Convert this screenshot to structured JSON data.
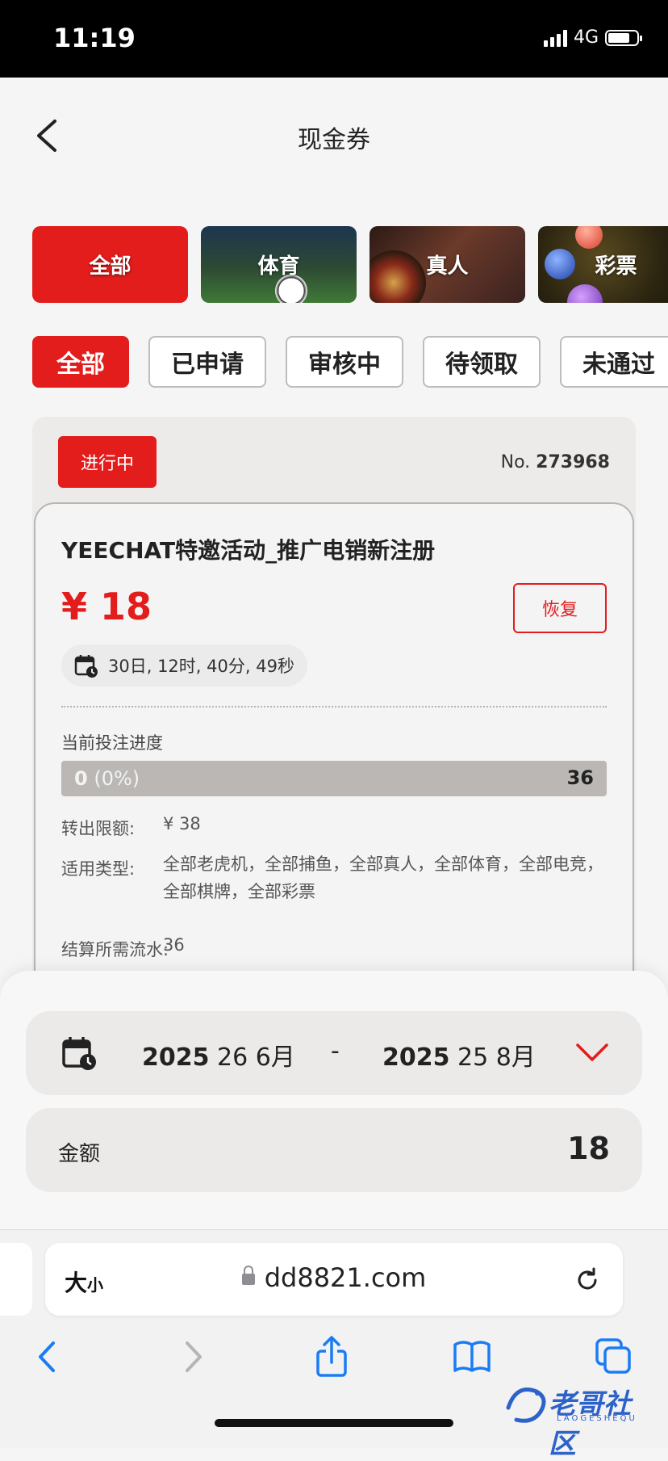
{
  "status_bar": {
    "time": "11:19",
    "network": "4G"
  },
  "header": {
    "title": "现金券"
  },
  "categories": [
    {
      "label": "全部",
      "active": true
    },
    {
      "label": "体育"
    },
    {
      "label": "真人"
    },
    {
      "label": "彩票"
    }
  ],
  "filters": [
    {
      "label": "全部",
      "active": true
    },
    {
      "label": "已申请"
    },
    {
      "label": "审核中"
    },
    {
      "label": "待领取"
    },
    {
      "label": "未通过"
    }
  ],
  "voucher": {
    "status": "进行中",
    "no_prefix": "No.",
    "no_value": "273968",
    "title": "YEECHAT特邀活动_推广电销新注册",
    "amount": "¥ 18",
    "restore_label": "恢复",
    "countdown": "30日, 12时, 40分, 49秒",
    "progress_label": "当前投注进度",
    "progress_current": "0",
    "progress_percent_text": "(0%)",
    "progress_fraction": 0,
    "progress_target": "36",
    "limit_label": "转出限额:",
    "limit_value": "¥ 38",
    "types_label": "适用类型:",
    "types_value": "全部老虎机，全部捕鱼，全部真人，全部体育，全部电竞，全部棋牌，全部彩票",
    "turnover_label": "结算所需流水:",
    "turnover_value": "36"
  },
  "date_filter": {
    "from_year": "2025",
    "from_rest": "26 6月",
    "separator": "-",
    "to_year": "2025",
    "to_rest": "25 8月"
  },
  "amount_filter": {
    "label": "金额",
    "value": "18"
  },
  "browser": {
    "text_size_big": "大",
    "text_size_small": "小",
    "url": "dd8821.com"
  },
  "watermark": {
    "text": "老哥社区",
    "sub": "LAOGESHEQU"
  },
  "colors": {
    "accent": "#e31d1c",
    "ios_blue": "#1a7cf5"
  }
}
